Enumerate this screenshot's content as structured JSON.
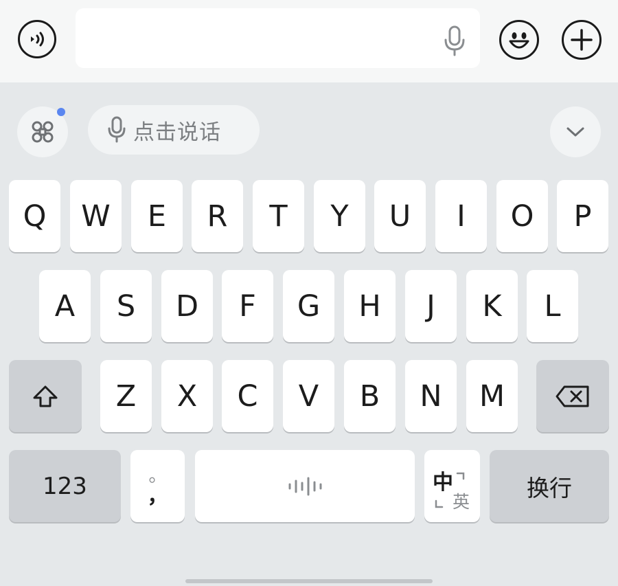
{
  "top_bar": {
    "voice_mode_icon": "speaker-waves-icon",
    "input": {
      "value": "",
      "placeholder": "",
      "mic_icon": "microphone-icon"
    },
    "emoji_icon": "smiley-icon",
    "add_icon": "plus-icon"
  },
  "keyboard": {
    "toolbar": {
      "apps_icon": "command-grid-icon",
      "voice_pill_label": "点击说话",
      "collapse_icon": "chevron-down-icon"
    },
    "rows": [
      [
        "Q",
        "W",
        "E",
        "R",
        "T",
        "Y",
        "U",
        "I",
        "O",
        "P"
      ],
      [
        "A",
        "S",
        "D",
        "F",
        "G",
        "H",
        "J",
        "K",
        "L"
      ],
      [
        "Z",
        "X",
        "C",
        "V",
        "B",
        "N",
        "M"
      ]
    ],
    "shift_icon": "shift-arrow-icon",
    "delete_icon": "backspace-icon",
    "bottom": {
      "numbers_label": "123",
      "punct_top": "。",
      "punct_bottom": "，",
      "space_icon": "voice-wave-icon",
      "lang_primary": "中",
      "lang_secondary": "英",
      "return_label": "换行"
    }
  },
  "colors": {
    "key_face": "#ffffff",
    "function_key": "#cdd0d4",
    "keyboard_bg": "#e5e8ea",
    "accent_dot": "#5a86f0"
  }
}
